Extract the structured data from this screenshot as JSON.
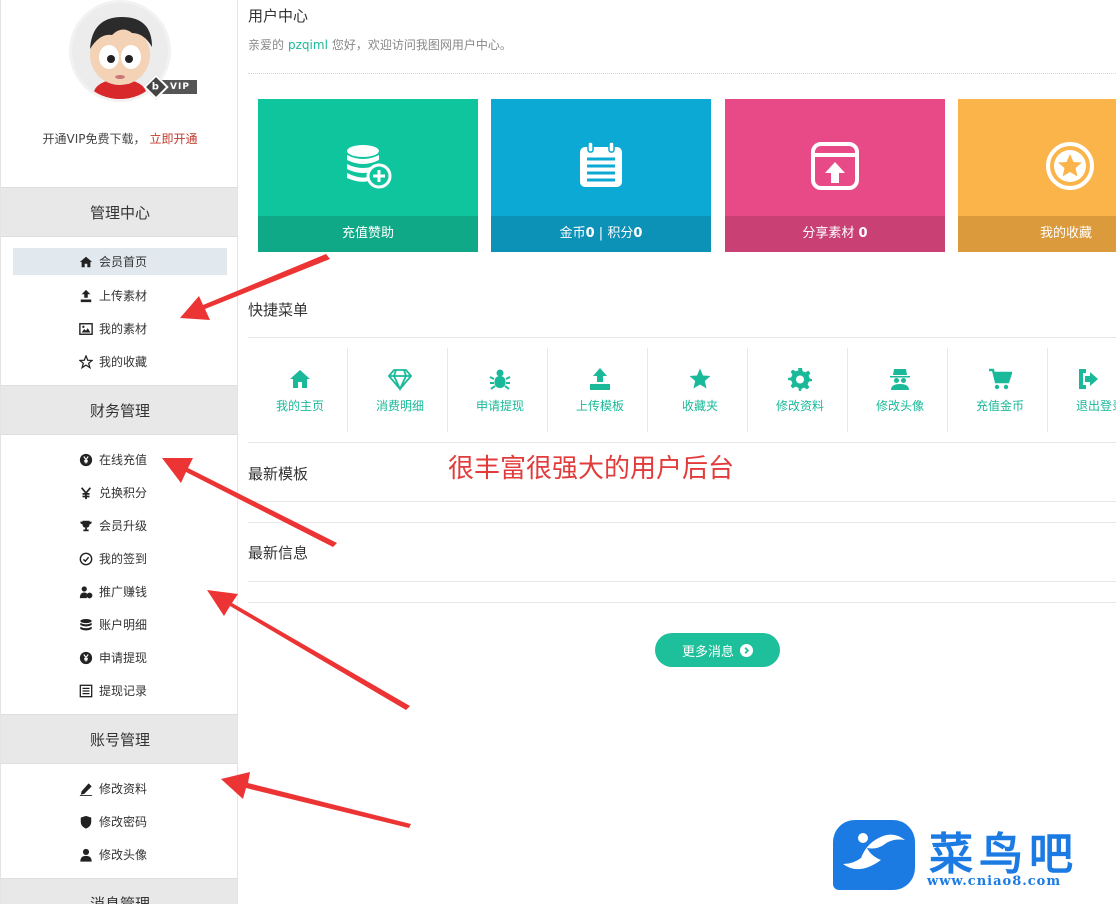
{
  "sidebar": {
    "vip_badge": "VIP",
    "vip_badge_letter": "b",
    "vip_line": "开通VIP免费下载，",
    "vip_link": "立即开通",
    "sections": [
      {
        "title": "管理中心",
        "items": [
          {
            "label": "会员首页",
            "icon": "home-icon",
            "active": true
          },
          {
            "label": "上传素材",
            "icon": "upload-icon"
          },
          {
            "label": "我的素材",
            "icon": "image-icon"
          },
          {
            "label": "我的收藏",
            "icon": "star-icon"
          }
        ]
      },
      {
        "title": "财务管理",
        "items": [
          {
            "label": "在线充值",
            "icon": "yen-circle-icon"
          },
          {
            "label": "兑换积分",
            "icon": "exchange-icon"
          },
          {
            "label": "会员升级",
            "icon": "trophy-icon"
          },
          {
            "label": "我的签到",
            "icon": "check-circle-icon"
          },
          {
            "label": "推广赚钱",
            "icon": "user-money-icon"
          },
          {
            "label": "账户明细",
            "icon": "database-icon"
          },
          {
            "label": "申请提现",
            "icon": "yen-circle-icon"
          },
          {
            "label": "提现记录",
            "icon": "list-icon"
          }
        ]
      },
      {
        "title": "账号管理",
        "items": [
          {
            "label": "修改资料",
            "icon": "pen-icon"
          },
          {
            "label": "修改密码",
            "icon": "shield-icon"
          },
          {
            "label": "修改头像",
            "icon": "user-icon"
          }
        ]
      },
      {
        "title": "消息管理",
        "items": []
      }
    ]
  },
  "main": {
    "title": "用户中心",
    "welcome_prefix": "亲爱的",
    "username": "pzqiml",
    "welcome_suffix": "您好，欢迎访问我图网用户中心。",
    "tiles": [
      {
        "label": "充值赞助",
        "icon": "coins-plus-icon",
        "color": "#0ec59e",
        "bar_color": "#10a987"
      },
      {
        "label_a": "金币",
        "value_a": "0",
        "sep": " | ",
        "label_b": "积分",
        "value_b": "0",
        "icon": "calendar-icon",
        "color": "#0ba9d4",
        "bar_color": "#0c91b7"
      },
      {
        "label": "分享素材 ",
        "value": "0",
        "icon": "share-upload-icon",
        "color": "#e84a88",
        "bar_color": "#c94075"
      },
      {
        "label": "我的收藏",
        "icon": "star-circle-icon",
        "color": "#fbb44a",
        "bar_color": "#db9a3b"
      }
    ],
    "quick_menu_title": "快捷菜单",
    "quick_menu": [
      {
        "label": "我的主页",
        "icon": "home-icon"
      },
      {
        "label": "消费明细",
        "icon": "diamond-icon"
      },
      {
        "label": "申请提现",
        "icon": "bug-icon"
      },
      {
        "label": "上传模板",
        "icon": "upload-icon"
      },
      {
        "label": "收藏夹",
        "icon": "star-icon"
      },
      {
        "label": "修改资料",
        "icon": "gear-icon"
      },
      {
        "label": "修改头像",
        "icon": "spy-icon"
      },
      {
        "label": "充值金币",
        "icon": "cart-icon"
      },
      {
        "label": "退出登录",
        "icon": "sign-out-icon"
      }
    ],
    "promo_text": "很丰富很强大的用户后台",
    "latest_templates_title": "最新模板",
    "latest_info_title": "最新信息",
    "more_button": "更多消息"
  },
  "logo": {
    "text": "菜鸟吧",
    "url": "www.cniao8.com",
    "color": "#1b7be3"
  }
}
